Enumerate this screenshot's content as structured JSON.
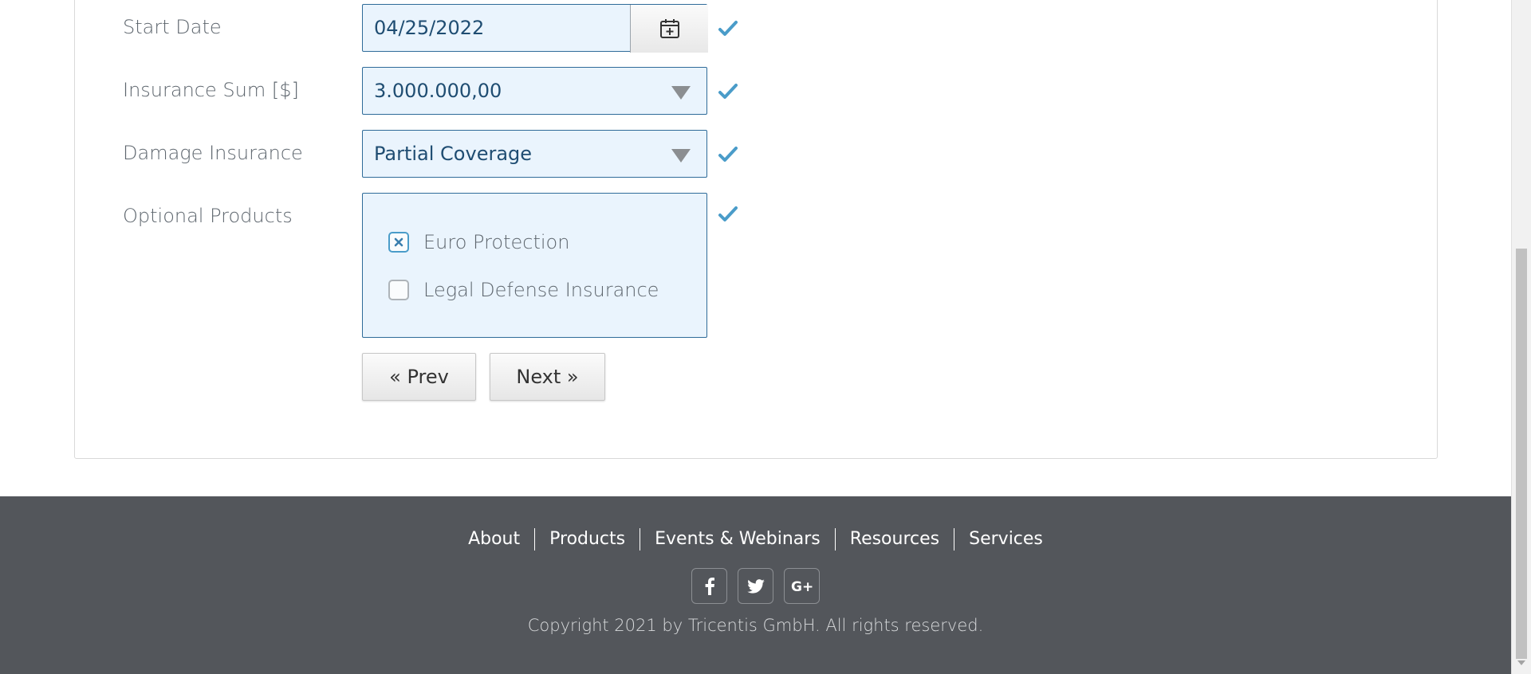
{
  "form": {
    "start_date": {
      "label": "Start Date",
      "value": "04/25/2022"
    },
    "insurance_sum": {
      "label": "Insurance Sum [$]",
      "value": "3.000.000,00"
    },
    "damage_insurance": {
      "label": "Damage Insurance",
      "value": "Partial Coverage"
    },
    "optional_products": {
      "label": "Optional Products",
      "options": [
        {
          "label": "Euro Protection",
          "checked": true
        },
        {
          "label": "Legal Defense Insurance",
          "checked": false
        }
      ]
    },
    "prev_label": "« Prev",
    "next_label": "Next »"
  },
  "footer": {
    "links": [
      "About",
      "Products",
      "Events & Webinars",
      "Resources",
      "Services"
    ],
    "social": [
      "facebook-icon",
      "twitter-icon",
      "google-plus-icon"
    ],
    "copyright": "Copyright 2021 by Tricentis GmbH. All rights reserved."
  },
  "colors": {
    "field_bg": "#eaf4fd",
    "field_border": "#2f6b99",
    "check": "#4a9cc9",
    "footer_bg": "#53565b"
  }
}
